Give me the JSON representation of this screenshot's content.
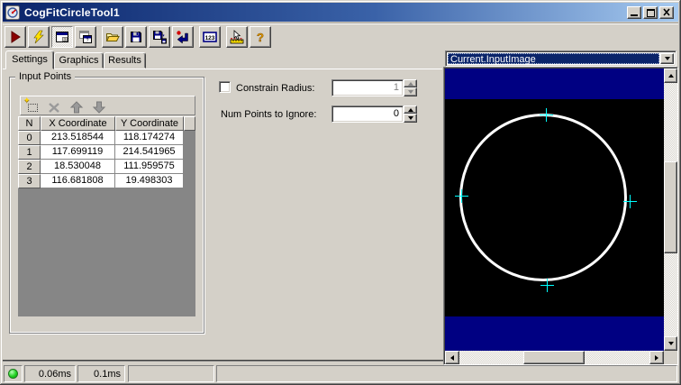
{
  "window": {
    "title": "CogFitCircleTool1",
    "controls": [
      "minimize",
      "maximize",
      "close"
    ]
  },
  "icons": {
    "question": "?",
    "calc": "123",
    "help": "?",
    "star": "✦"
  },
  "toolbar": {
    "buttons": [
      "run-tool",
      "run-tool-electric",
      "show-tool-editor",
      "float-tool-editor",
      "open-file",
      "save-file",
      "save-subset",
      "reset-tool",
      "show-numeric-results",
      "interactive-graphics",
      "help"
    ]
  },
  "tabs": {
    "active": "Settings",
    "items": [
      {
        "label": "Settings"
      },
      {
        "label": "Graphics"
      },
      {
        "label": "Results"
      }
    ]
  },
  "input_points": {
    "label": "Input Points",
    "toolbar": [
      "add-point",
      "delete-point",
      "move-point-up",
      "move-point-down"
    ],
    "grid": {
      "columns": [
        "N",
        "X Coordinate",
        "Y Coordinate"
      ],
      "rows": [
        [
          "0",
          "213.518544",
          "118.174274"
        ],
        [
          "1",
          "117.699119",
          "214.541965"
        ],
        [
          "2",
          "18.530048",
          "111.959575"
        ],
        [
          "3",
          "116.681808",
          "19.498303"
        ]
      ]
    }
  },
  "parameters": {
    "constrain_radius": {
      "label": "Constrain Radius:",
      "value": "1",
      "checked": false,
      "enabled": false
    },
    "num_points_to_ignore": {
      "label": "Num Points to Ignore:",
      "value": "0",
      "enabled": true
    }
  },
  "image_panel": {
    "selected_image": "Current.InputImage"
  },
  "status_bar": {
    "tool_time": "0.06ms",
    "total_time": "0.1ms"
  },
  "colors": {
    "face": "#d4d0c8",
    "title_start": "#0a246a",
    "title_end": "#a6caf0",
    "band": "#000082",
    "image_bg": "#000000",
    "circle": "#ffffff",
    "marker": "#00ffff",
    "selection": "#0a246a",
    "led": "#21d221"
  }
}
